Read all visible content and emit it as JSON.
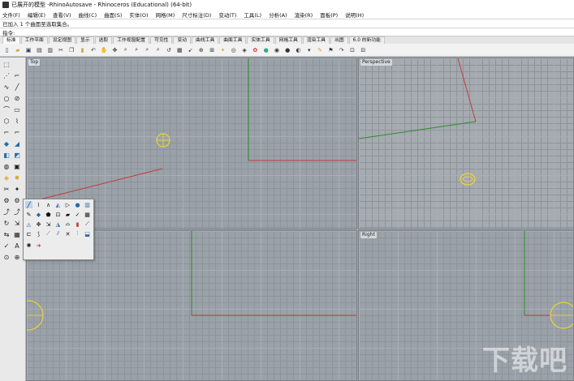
{
  "window": {
    "title": "已展开的模型 -RhinoAutosave - Rhinoceros (Educational) (64-bit)"
  },
  "menu": [
    "文件(F)",
    "编辑(E)",
    "查看(V)",
    "曲线(C)",
    "曲面(S)",
    "实体(O)",
    "网格(M)",
    "尺寸标注(D)",
    "变动(T)",
    "工具(L)",
    "分析(A)",
    "渲染(R)",
    "面板(P)",
    "说明(H)"
  ],
  "command": {
    "history": "已加入 1 个曲面至选取集合。",
    "prompt": "指令:"
  },
  "tabs": [
    "标准",
    "工作平面",
    "设定视图",
    "显示",
    "选取",
    "工作视窗配置",
    "可见性",
    "变动",
    "曲线工具",
    "曲面工具",
    "实体工具",
    "网格工具",
    "渲染工具",
    "出图",
    "6.0 的新功能"
  ],
  "viewports": {
    "top": "Top",
    "perspective": "Perspective",
    "front": "",
    "right": "Right"
  },
  "toolbar_icons": [
    "new-icon",
    "open-icon",
    "save-icon",
    "print-icon",
    "import-icon",
    "cut-icon",
    "copy-icon",
    "paste-icon",
    "undo-icon",
    "pan-icon",
    "rotate-icon",
    "zoom-icon",
    "zoom-window-icon",
    "zoom-extents-icon",
    "zoom-selected-icon",
    "undo-view-icon",
    "grid-icon",
    "select-icon",
    "osnap-icon",
    "cplane-icon",
    "light-icon",
    "camera-icon",
    "layer-icon",
    "properties-icon",
    "color-icon",
    "material-icon",
    "render-icon",
    "sphere-icon",
    "lock-icon",
    "options-icon",
    "move-icon",
    "redo-icon",
    "view-icon",
    "group-icon"
  ],
  "watermark": "下载吧",
  "colors": {
    "accent_red": "#c43a3a",
    "accent_green": "#2e8b2e",
    "accent_yellow": "#e8d530"
  }
}
